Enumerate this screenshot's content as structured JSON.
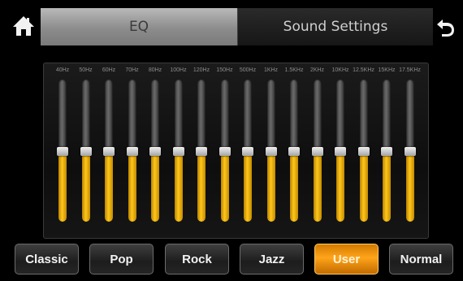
{
  "header": {
    "home_icon": "home-icon",
    "back_icon": "back-arrow-icon",
    "tabs": [
      {
        "label": "EQ",
        "active": true
      },
      {
        "label": "Sound Settings",
        "active": false
      }
    ]
  },
  "equalizer": {
    "bands": [
      {
        "freq": "40Hz",
        "level": 0.5
      },
      {
        "freq": "50Hz",
        "level": 0.5
      },
      {
        "freq": "60Hz",
        "level": 0.5
      },
      {
        "freq": "70Hz",
        "level": 0.5
      },
      {
        "freq": "80Hz",
        "level": 0.5
      },
      {
        "freq": "100Hz",
        "level": 0.5
      },
      {
        "freq": "120Hz",
        "level": 0.5
      },
      {
        "freq": "150Hz",
        "level": 0.5
      },
      {
        "freq": "500Hz",
        "level": 0.5
      },
      {
        "freq": "1KHz",
        "level": 0.5
      },
      {
        "freq": "1.5KHz",
        "level": 0.5
      },
      {
        "freq": "2KHz",
        "level": 0.5
      },
      {
        "freq": "10KHz",
        "level": 0.5
      },
      {
        "freq": "12.5KHz",
        "level": 0.5
      },
      {
        "freq": "15KHz",
        "level": 0.5
      },
      {
        "freq": "17.5KHz",
        "level": 0.5
      }
    ]
  },
  "presets": [
    {
      "label": "Classic",
      "active": false
    },
    {
      "label": "Pop",
      "active": false
    },
    {
      "label": "Rock",
      "active": false
    },
    {
      "label": "Jazz",
      "active": false
    },
    {
      "label": "User",
      "active": true
    },
    {
      "label": "Normal",
      "active": false
    }
  ],
  "colors": {
    "accent": "#ffb21a",
    "slider_fill": "#ffc000",
    "background": "#000000"
  }
}
